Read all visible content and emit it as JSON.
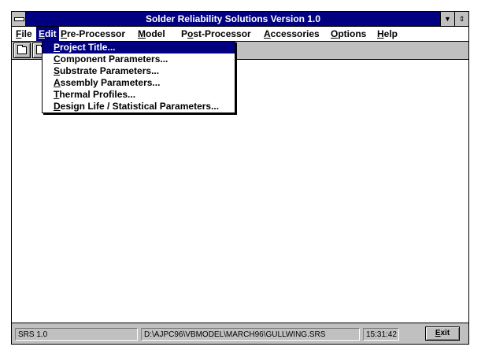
{
  "window": {
    "title": "Solder Reliability Solutions Version 1.0"
  },
  "title_buttons": {
    "minimize_glyph": "▼",
    "maximize_glyph": "⇕"
  },
  "menubar": {
    "items": [
      {
        "label": "File",
        "mnemonic": "F"
      },
      {
        "label": "Edit",
        "mnemonic": "E"
      },
      {
        "label": "Pre-Processor",
        "mnemonic": "P"
      },
      {
        "label": "Model",
        "mnemonic": "M"
      },
      {
        "label": "Post-Processor",
        "mnemonic": "o"
      },
      {
        "label": "Accessories",
        "mnemonic": "A"
      },
      {
        "label": "Options",
        "mnemonic": "O"
      },
      {
        "label": "Help",
        "mnemonic": "H"
      }
    ],
    "active": "Edit"
  },
  "toolbar": {
    "icons": [
      "folder-icon",
      "folder-icon"
    ]
  },
  "edit_menu": {
    "items": [
      {
        "label": "Project Title..."
      },
      {
        "label": "Component Parameters..."
      },
      {
        "label": "Substrate Parameters..."
      },
      {
        "label": "Assembly Parameters..."
      },
      {
        "label": "Thermal Profiles..."
      },
      {
        "label": "Design Life / Statistical Parameters..."
      }
    ],
    "highlighted": "Project Title..."
  },
  "statusbar": {
    "version": "SRS 1.0",
    "path": "D:\\AJPC96\\VBMODEL\\MARCH96\\GULLWING.SRS",
    "time": "15:31:42",
    "exit_label": "Exit"
  },
  "colors": {
    "title_bar": "#000080",
    "highlight": "#000080",
    "chrome_gray": "#c0c0c0"
  }
}
